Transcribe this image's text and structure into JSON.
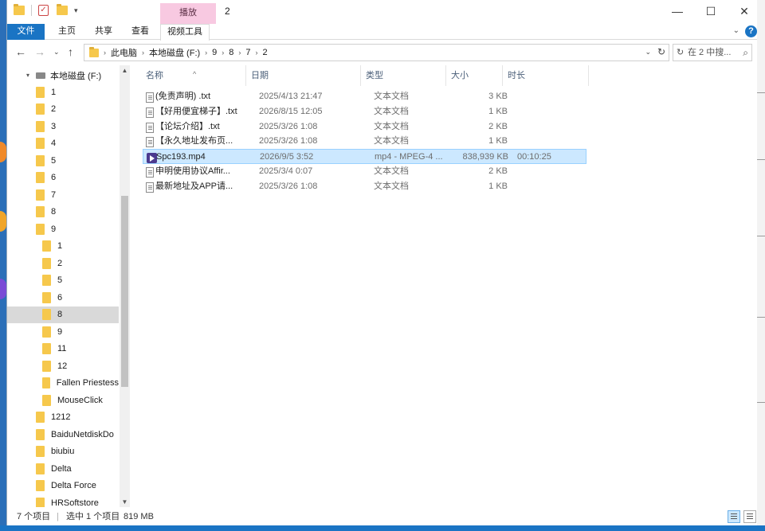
{
  "window": {
    "title": "2",
    "context_tab": "播放",
    "controls": {
      "minimize": "—",
      "maximize": "☐",
      "close": "✕"
    }
  },
  "ribbon": {
    "tabs": [
      "文件",
      "主页",
      "共享",
      "查看",
      "视频工具"
    ]
  },
  "address": {
    "path": [
      "此电脑",
      "本地磁盘 (F:)",
      "9",
      "8",
      "7",
      "2"
    ],
    "search_placeholder": "在 2 中搜..."
  },
  "nav": {
    "drive": "本地磁盘 (F:)",
    "items": [
      {
        "label": "1",
        "level": 1
      },
      {
        "label": "2",
        "level": 1
      },
      {
        "label": "3",
        "level": 1
      },
      {
        "label": "4",
        "level": 1
      },
      {
        "label": "5",
        "level": 1
      },
      {
        "label": "6",
        "level": 1
      },
      {
        "label": "7",
        "level": 1
      },
      {
        "label": "8",
        "level": 1
      },
      {
        "label": "9",
        "level": 1
      },
      {
        "label": "1",
        "level": 2
      },
      {
        "label": "2",
        "level": 2
      },
      {
        "label": "5",
        "level": 2
      },
      {
        "label": "6",
        "level": 2
      },
      {
        "label": "8",
        "level": 2,
        "selected": true
      },
      {
        "label": "9",
        "level": 2
      },
      {
        "label": "11",
        "level": 2
      },
      {
        "label": "12",
        "level": 2
      },
      {
        "label": "Fallen Priestess",
        "level": 2
      },
      {
        "label": "MouseClick",
        "level": 2
      },
      {
        "label": "1212",
        "level": 1
      },
      {
        "label": "BaiduNetdiskDo",
        "level": 1
      },
      {
        "label": "biubiu",
        "level": 1
      },
      {
        "label": "Delta",
        "level": 1
      },
      {
        "label": "Delta Force",
        "level": 1
      },
      {
        "label": "HRSoftstore",
        "level": 1
      }
    ]
  },
  "files": {
    "columns": [
      "名称",
      "日期",
      "类型",
      "大小",
      "时长"
    ],
    "rows": [
      {
        "name": "(免责声明) .txt",
        "date": "2025/4/13 21:47",
        "type": "文本文档",
        "size": "3 KB",
        "duration": "",
        "icon": "txt"
      },
      {
        "name": "【好用便宜梯子】.txt",
        "date": "2026/8/15 12:05",
        "type": "文本文档",
        "size": "1 KB",
        "duration": "",
        "icon": "txt"
      },
      {
        "name": "【论坛介绍】.txt",
        "date": "2025/3/26 1:08",
        "type": "文本文档",
        "size": "2 KB",
        "duration": "",
        "icon": "txt"
      },
      {
        "name": "【永久地址发布页...",
        "date": "2025/3/26 1:08",
        "type": "文本文档",
        "size": "1 KB",
        "duration": "",
        "icon": "txt"
      },
      {
        "name": "Spc193.mp4",
        "date": "2026/9/5 3:52",
        "type": "mp4 - MPEG-4 ...",
        "size": "838,939 KB",
        "duration": "00:10:25",
        "icon": "video",
        "selected": true
      },
      {
        "name": "申明使用协议Affir...",
        "date": "2025/3/4 0:07",
        "type": "文本文档",
        "size": "2 KB",
        "duration": "",
        "icon": "txt"
      },
      {
        "name": "最新地址及APP请...",
        "date": "2025/3/26 1:08",
        "type": "文本文档",
        "size": "1 KB",
        "duration": "",
        "icon": "txt"
      }
    ]
  },
  "status": {
    "count": "7 个项目",
    "selected": "选中 1 个项目",
    "size": "819 MB"
  }
}
